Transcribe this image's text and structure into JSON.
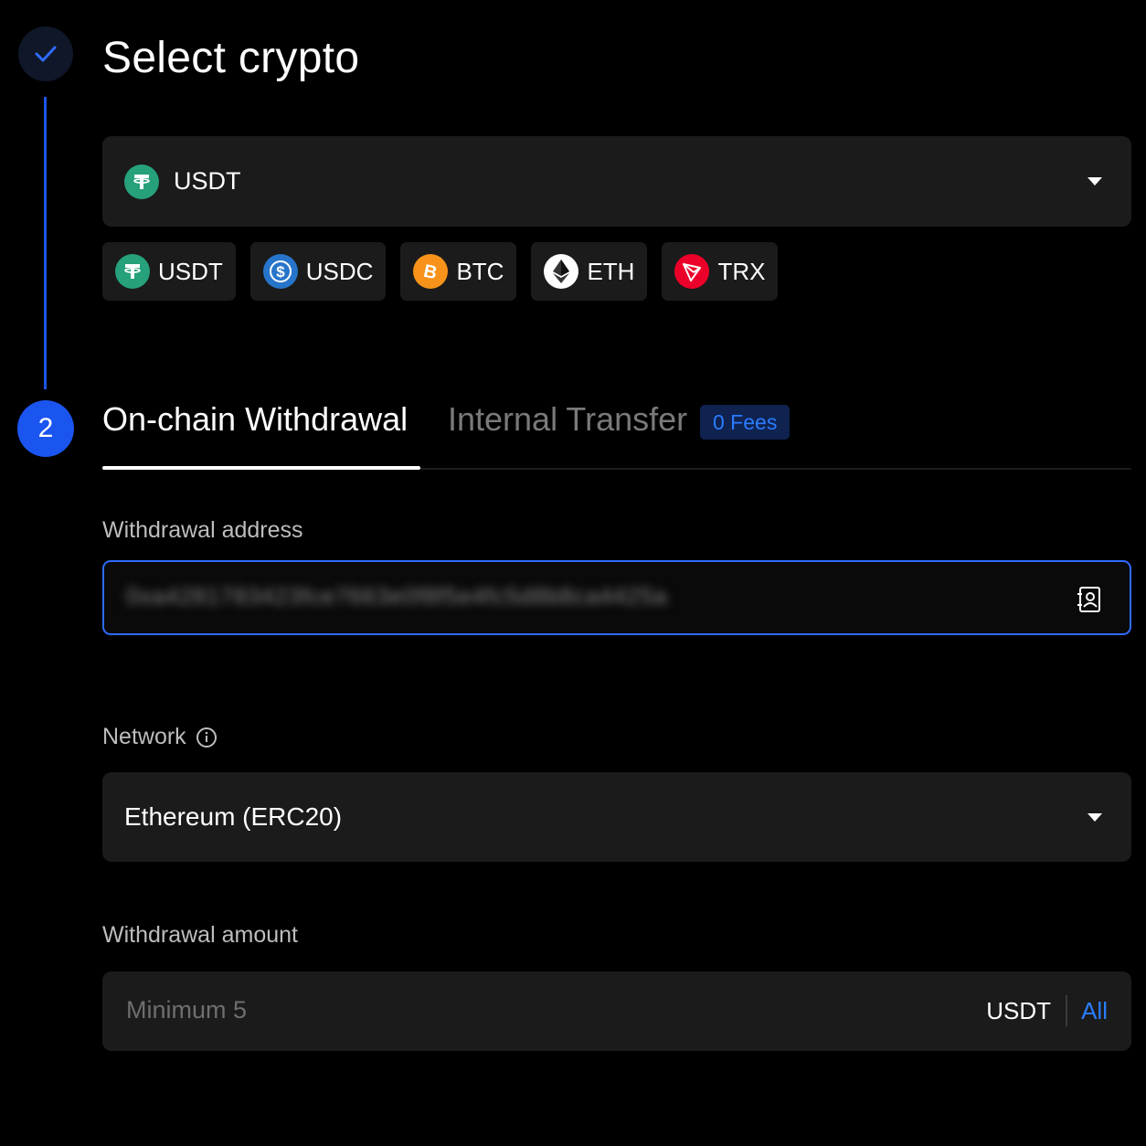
{
  "steps": {
    "step1": {
      "title": "Select crypto",
      "state": "done"
    },
    "step2": {
      "number": "2"
    }
  },
  "crypto_select": {
    "selected": "USDT",
    "icon": "tether-icon"
  },
  "quick_coins": [
    {
      "label": "USDT",
      "icon": "tether-icon",
      "color": "#26a17b"
    },
    {
      "label": "USDC",
      "icon": "usdc-icon",
      "color": "#2775ca"
    },
    {
      "label": "BTC",
      "icon": "bitcoin-icon",
      "color": "#f7931a"
    },
    {
      "label": "ETH",
      "icon": "ethereum-icon",
      "color": "#ffffff"
    },
    {
      "label": "TRX",
      "icon": "tron-icon",
      "color": "#eb0029"
    }
  ],
  "tabs": {
    "active": "On-chain Withdrawal",
    "inactive": "Internal Transfer",
    "badge": "0 Fees"
  },
  "address": {
    "label": "Withdrawal address",
    "value": "0xa4281783423fce7663e0f8f5e4fc5d8b8ca4425a"
  },
  "network": {
    "label": "Network",
    "selected": "Ethereum (ERC20)"
  },
  "amount": {
    "label": "Withdrawal amount",
    "placeholder": "Minimum 5",
    "unit": "USDT",
    "all_label": "All"
  },
  "colors": {
    "accent": "#2b7cff",
    "background": "#000000",
    "field": "#1b1b1b"
  }
}
